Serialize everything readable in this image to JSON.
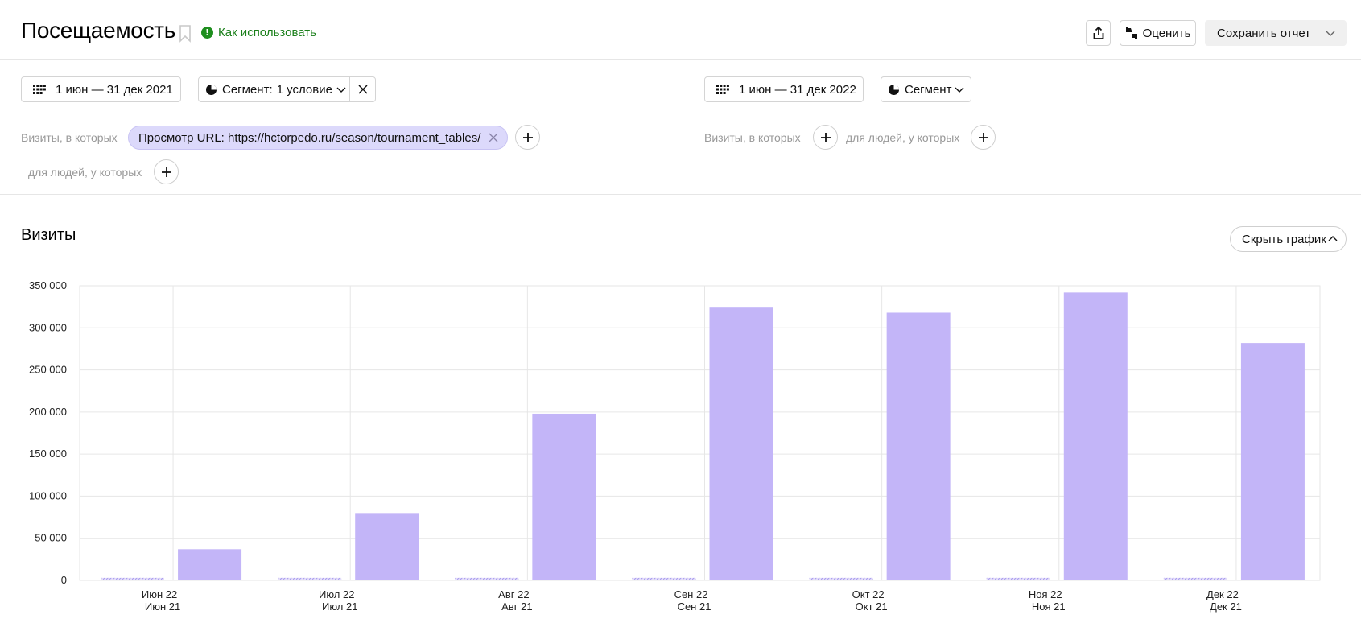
{
  "header": {
    "title": "Посещаемость",
    "how_to_use": "Как использовать",
    "rate_label": "Оценить",
    "save_report_label": "Сохранить отчет"
  },
  "left_panel": {
    "date_range": "1 июн — 31 дек 2021",
    "segment_label": "Сегмент:",
    "segment_value": "1 условие",
    "visits_where": "Визиты, в которых",
    "filter_tag": "Просмотр URL: https://hctorpedo.ru/season/tournament_tables/",
    "people_where": "для людей, у которых"
  },
  "right_panel": {
    "date_range": "1 июн — 31 дек 2022",
    "segment_label": "Сегмент",
    "visits_where": "Визиты, в которых",
    "people_where": "для людей, у которых"
  },
  "chart_section": {
    "title": "Визиты",
    "hide_chart_label": "Скрыть график"
  },
  "colors": {
    "bar_primary": "#c3b5f8",
    "bar_secondary_stripe": "#a99cf0",
    "grid": "#e6e6e6",
    "accent_green": "#1e8e1e",
    "filter_tag_bg": "#dcd9fb"
  },
  "chart_data": {
    "type": "bar",
    "categories_top": [
      "Июн 22",
      "Июл 22",
      "Авг 22",
      "Сен 22",
      "Окт 22",
      "Ноя 22",
      "Дек 22"
    ],
    "categories_bottom": [
      "Июн 21",
      "Июл 21",
      "Авг 21",
      "Сен 21",
      "Окт 21",
      "Ноя 21",
      "Дек 21"
    ],
    "series": [
      {
        "values": [
          3000,
          3000,
          3000,
          3000,
          3000,
          3000,
          3000
        ]
      },
      {
        "values": [
          37000,
          80000,
          198000,
          324000,
          318000,
          342000,
          282000
        ]
      }
    ],
    "ylim": [
      0,
      350000
    ],
    "yticks": [
      0,
      50000,
      100000,
      150000,
      200000,
      250000,
      300000,
      350000
    ],
    "ytick_labels": [
      "0",
      "50 000",
      "100 000",
      "150 000",
      "200 000",
      "250 000",
      "300 000",
      "350 000"
    ],
    "grid": true
  }
}
